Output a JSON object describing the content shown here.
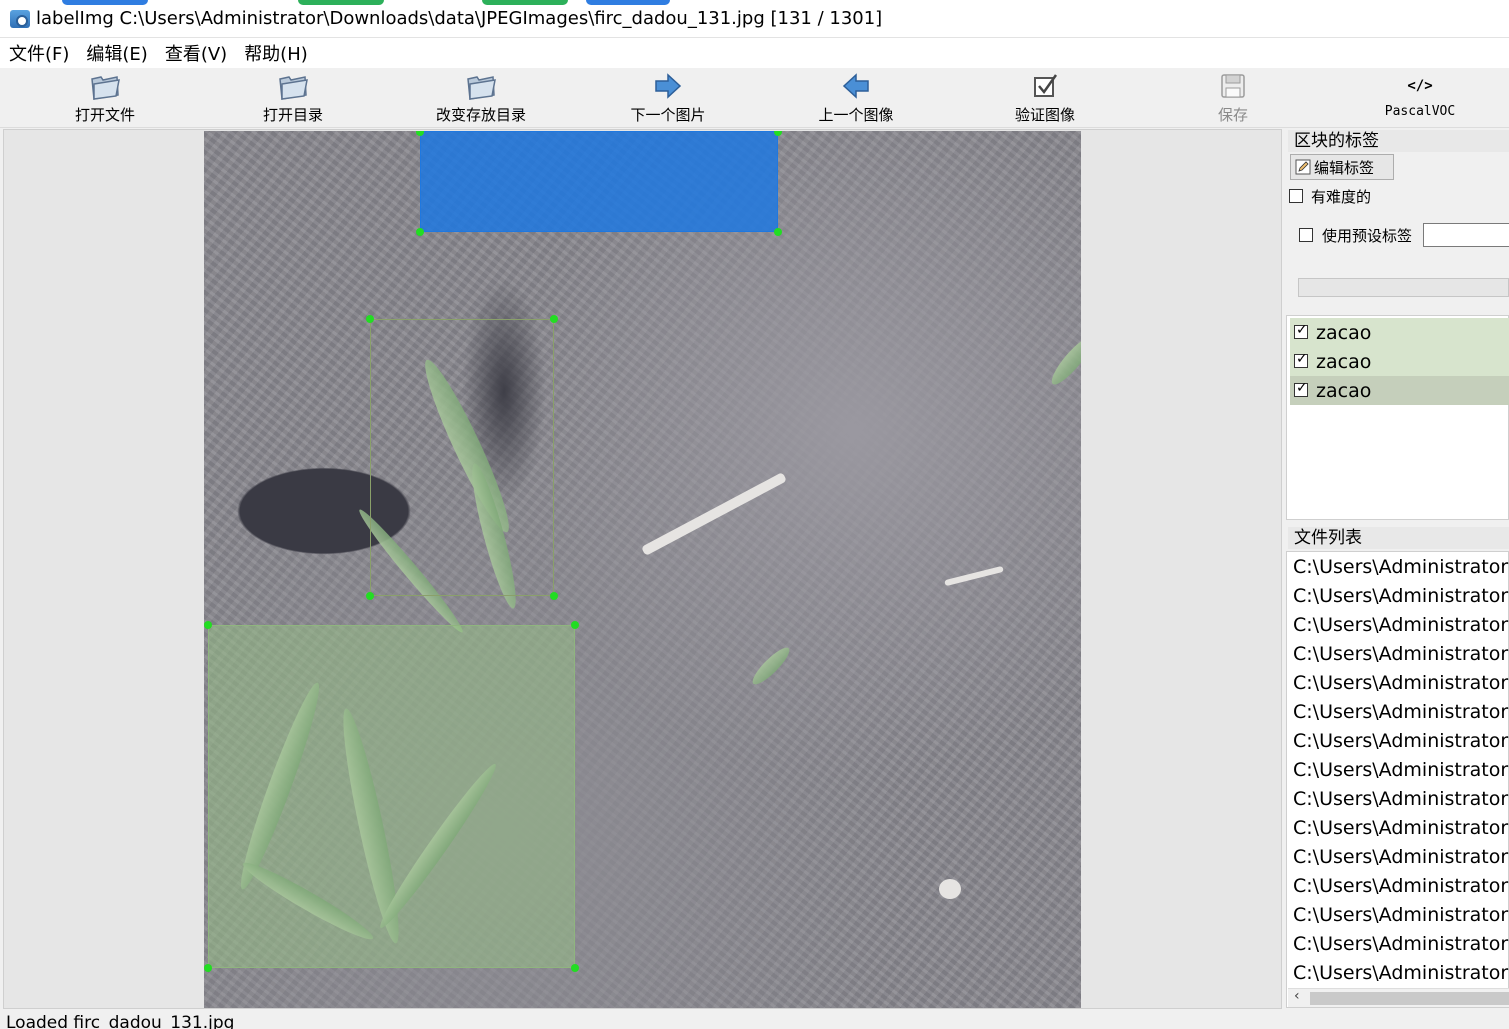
{
  "window": {
    "title": "labelImg C:\\Users\\Administrator\\Downloads\\data\\JPEGImages\\firc_dadou_131.jpg [131 / 1301]"
  },
  "menu": [
    "文件(F)",
    "编辑(E)",
    "查看(V)",
    "帮助(H)"
  ],
  "toolbar": {
    "open_file": "打开文件",
    "open_dir": "打开目录",
    "change_save_dir": "改变存放目录",
    "next_image": "下一个图片",
    "prev_image": "上一个图像",
    "verify_image": "验证图像",
    "save": "保存",
    "format": "PascalVOC"
  },
  "label_panel": {
    "title": "区块的标签",
    "edit_label": "编辑标签",
    "difficult": "有难度的",
    "use_default_label": "使用预设标签",
    "default_label_value": "",
    "labels": [
      {
        "name": "zacao",
        "checked": true,
        "color": "#d7e4cd"
      },
      {
        "name": "zacao",
        "checked": true,
        "color": "#d7e4cd"
      },
      {
        "name": "zacao",
        "checked": true,
        "color": "#c5cfbb"
      }
    ]
  },
  "file_panel": {
    "title": "文件列表",
    "files": [
      "C:\\Users\\Administrator",
      "C:\\Users\\Administrator",
      "C:\\Users\\Administrator",
      "C:\\Users\\Administrator",
      "C:\\Users\\Administrator",
      "C:\\Users\\Administrator",
      "C:\\Users\\Administrator",
      "C:\\Users\\Administrator",
      "C:\\Users\\Administrator",
      "C:\\Users\\Administrator",
      "C:\\Users\\Administrator",
      "C:\\Users\\Administrator",
      "C:\\Users\\Administrator",
      "C:\\Users\\Administrator",
      "C:\\Users\\Administrator"
    ]
  },
  "status": "Loaded firc_dadou_131.jpg",
  "colors": {
    "selected_box_fill": "#1f78e0",
    "box_fill": "#a6d99a",
    "handle": "#22dd22"
  }
}
